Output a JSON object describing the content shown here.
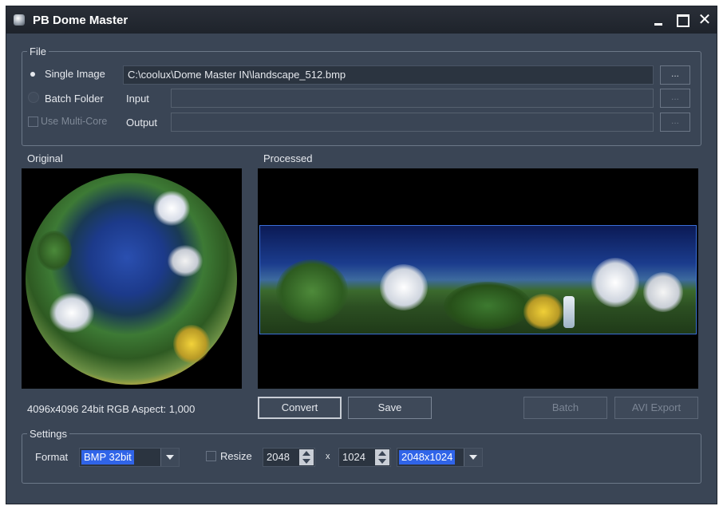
{
  "window": {
    "title": "PB Dome Master",
    "controls": {
      "minimize": "minimize-icon",
      "maximize": "maximize-icon",
      "close": "✕"
    }
  },
  "file": {
    "legend": "File",
    "single_image": {
      "label": "Single Image",
      "selected": true,
      "value": "C:\\coolux\\Dome Master IN\\landscape_512.bmp"
    },
    "batch_folder": {
      "label": "Batch Folder",
      "selected": false,
      "input_label": "Input",
      "value": ""
    },
    "multicore": {
      "label": "Use Multi-Core",
      "checked": false,
      "output_label": "Output",
      "value": ""
    },
    "browse_label": "..."
  },
  "preview": {
    "original_label": "Original",
    "processed_label": "Processed",
    "info": "4096x4096 24bit RGB Aspect: 1,000"
  },
  "actions": {
    "convert": "Convert",
    "save": "Save",
    "batch": "Batch",
    "avi_export": "AVI Export"
  },
  "settings": {
    "legend": "Settings",
    "format_label": "Format",
    "format_value": "BMP 32bit",
    "resize_label": "Resize",
    "resize_checked": false,
    "width": "2048",
    "times": "x",
    "height": "1024",
    "preset": "2048x1024"
  },
  "colors": {
    "window_bg": "#3a4555",
    "selection": "#3064e8",
    "titlebar": "#1e232b"
  }
}
